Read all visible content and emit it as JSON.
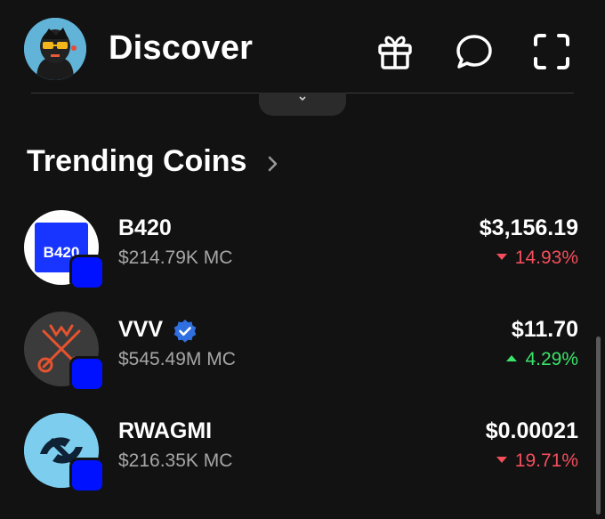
{
  "header": {
    "title": "Discover",
    "icons": [
      "gift-icon",
      "chat-icon",
      "scan-icon"
    ]
  },
  "section": {
    "title": "Trending Coins"
  },
  "coins": [
    {
      "name": "B420",
      "logo_text": "B420",
      "market_cap": "$214.79K MC",
      "price": "$3,156.19",
      "change": "14.93%",
      "direction": "down",
      "verified": false
    },
    {
      "name": "VVV",
      "market_cap": "$545.49M MC",
      "price": "$11.70",
      "change": "4.29%",
      "direction": "up",
      "verified": true
    },
    {
      "name": "RWAGMI",
      "market_cap": "$216.35K MC",
      "price": "$0.00021",
      "change": "19.71%",
      "direction": "down",
      "verified": false
    }
  ],
  "colors": {
    "background": "#121212",
    "negative": "#f34e5c",
    "positive": "#3be26b",
    "chain_badge": "#0011ff",
    "verified": "#2f6fe0"
  }
}
